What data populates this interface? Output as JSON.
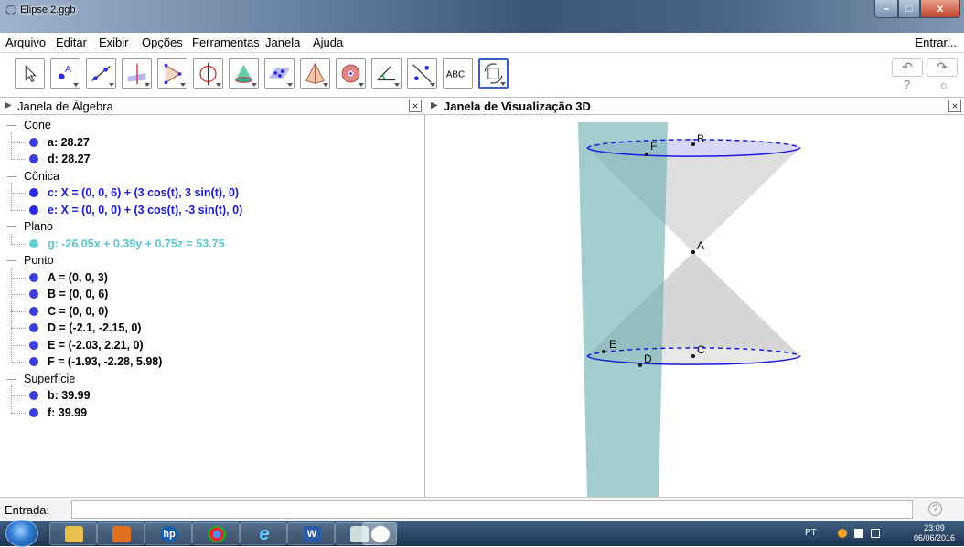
{
  "window": {
    "title": "Elipse 2.ggb",
    "minimize": "–",
    "maximize": "□",
    "close": "x"
  },
  "menu": {
    "items": [
      "Arquivo",
      "Editar",
      "Exibir",
      "Opções",
      "Ferramentas",
      "Janela",
      "Ajuda"
    ],
    "login": "Entrar..."
  },
  "toolbar": {
    "text_tool_label": "ABC",
    "tools": [
      "move-tool",
      "point-tool",
      "line-tool",
      "perpendicular-tool",
      "polygon-tool",
      "circle-axis-tool",
      "intersect-surfaces-tool",
      "plane-tool",
      "pyramid-tool",
      "sphere-tool",
      "angle-tool",
      "reflect-tool",
      "text-tool",
      "rotate-view-tool"
    ],
    "selected_tool": "rotate-view-tool",
    "undo": "↶",
    "redo": "↷",
    "help": "?",
    "settings": "☼"
  },
  "algebra_panel": {
    "title": "Janela de Álgebra",
    "close": "×",
    "groups": [
      {
        "label": "Cone",
        "items": [
          {
            "text": "a: 28.27",
            "color": "#3b3fd6",
            "text_color": "#000000"
          },
          {
            "text": "d: 28.27",
            "color": "#3b3fd6",
            "text_color": "#000000"
          }
        ]
      },
      {
        "label": "Cônica",
        "items": [
          {
            "text": "c: X = (0, 0, 6) + (3 cos(t), 3 sin(t), 0)",
            "color": "#2a2adf",
            "text_color": "#1a1ad0"
          },
          {
            "text": "e: X = (0, 0, 0) + (3 cos(t), -3 sin(t), 0)",
            "color": "#2a2adf",
            "text_color": "#1a1ad0"
          }
        ]
      },
      {
        "label": "Plano",
        "items": [
          {
            "text": "g: -26.05x + 0.39y + 0.75z = 53.75",
            "color": "#6bcfd8",
            "text_color": "#5cc4d0"
          }
        ]
      },
      {
        "label": "Ponto",
        "items": [
          {
            "text": "A = (0, 0, 3)",
            "color": "#3b3fd6",
            "text_color": "#000000"
          },
          {
            "text": "B = (0, 0, 6)",
            "color": "#3b3fd6",
            "text_color": "#000000"
          },
          {
            "text": "C = (0, 0, 0)",
            "color": "#3b3fd6",
            "text_color": "#000000"
          },
          {
            "text": "D = (-2.1, -2.15, 0)",
            "color": "#3b3fd6",
            "text_color": "#000000"
          },
          {
            "text": "E = (-2.03, 2.21, 0)",
            "color": "#3b3fd6",
            "text_color": "#000000"
          },
          {
            "text": "F = (-1.93, -2.28, 5.98)",
            "color": "#3b3fd6",
            "text_color": "#000000"
          }
        ]
      },
      {
        "label": "Superfície",
        "items": [
          {
            "text": "b: 39.99",
            "color": "#3b3fd6",
            "text_color": "#000000"
          },
          {
            "text": "f: 39.99",
            "color": "#3b3fd6",
            "text_color": "#000000"
          }
        ]
      }
    ]
  },
  "view3d_panel": {
    "title": "Janela de Visualização 3D",
    "close": "×",
    "point_labels": [
      "F",
      "B",
      "A",
      "E",
      "C",
      "D"
    ]
  },
  "input_bar": {
    "label": "Entrada:",
    "value": "",
    "help": "?"
  },
  "taskbar": {
    "apps": [
      "explorer-icon",
      "media-player-icon",
      "hp-icon",
      "chrome-icon",
      "ie-icon",
      "word-icon",
      "paint-icon",
      "geogebra-icon"
    ],
    "app_glyphs": {
      "hp": "hp",
      "word": "W",
      "ie": "e"
    },
    "language": "PT",
    "time": "23:09",
    "date": "06/06/2016"
  }
}
